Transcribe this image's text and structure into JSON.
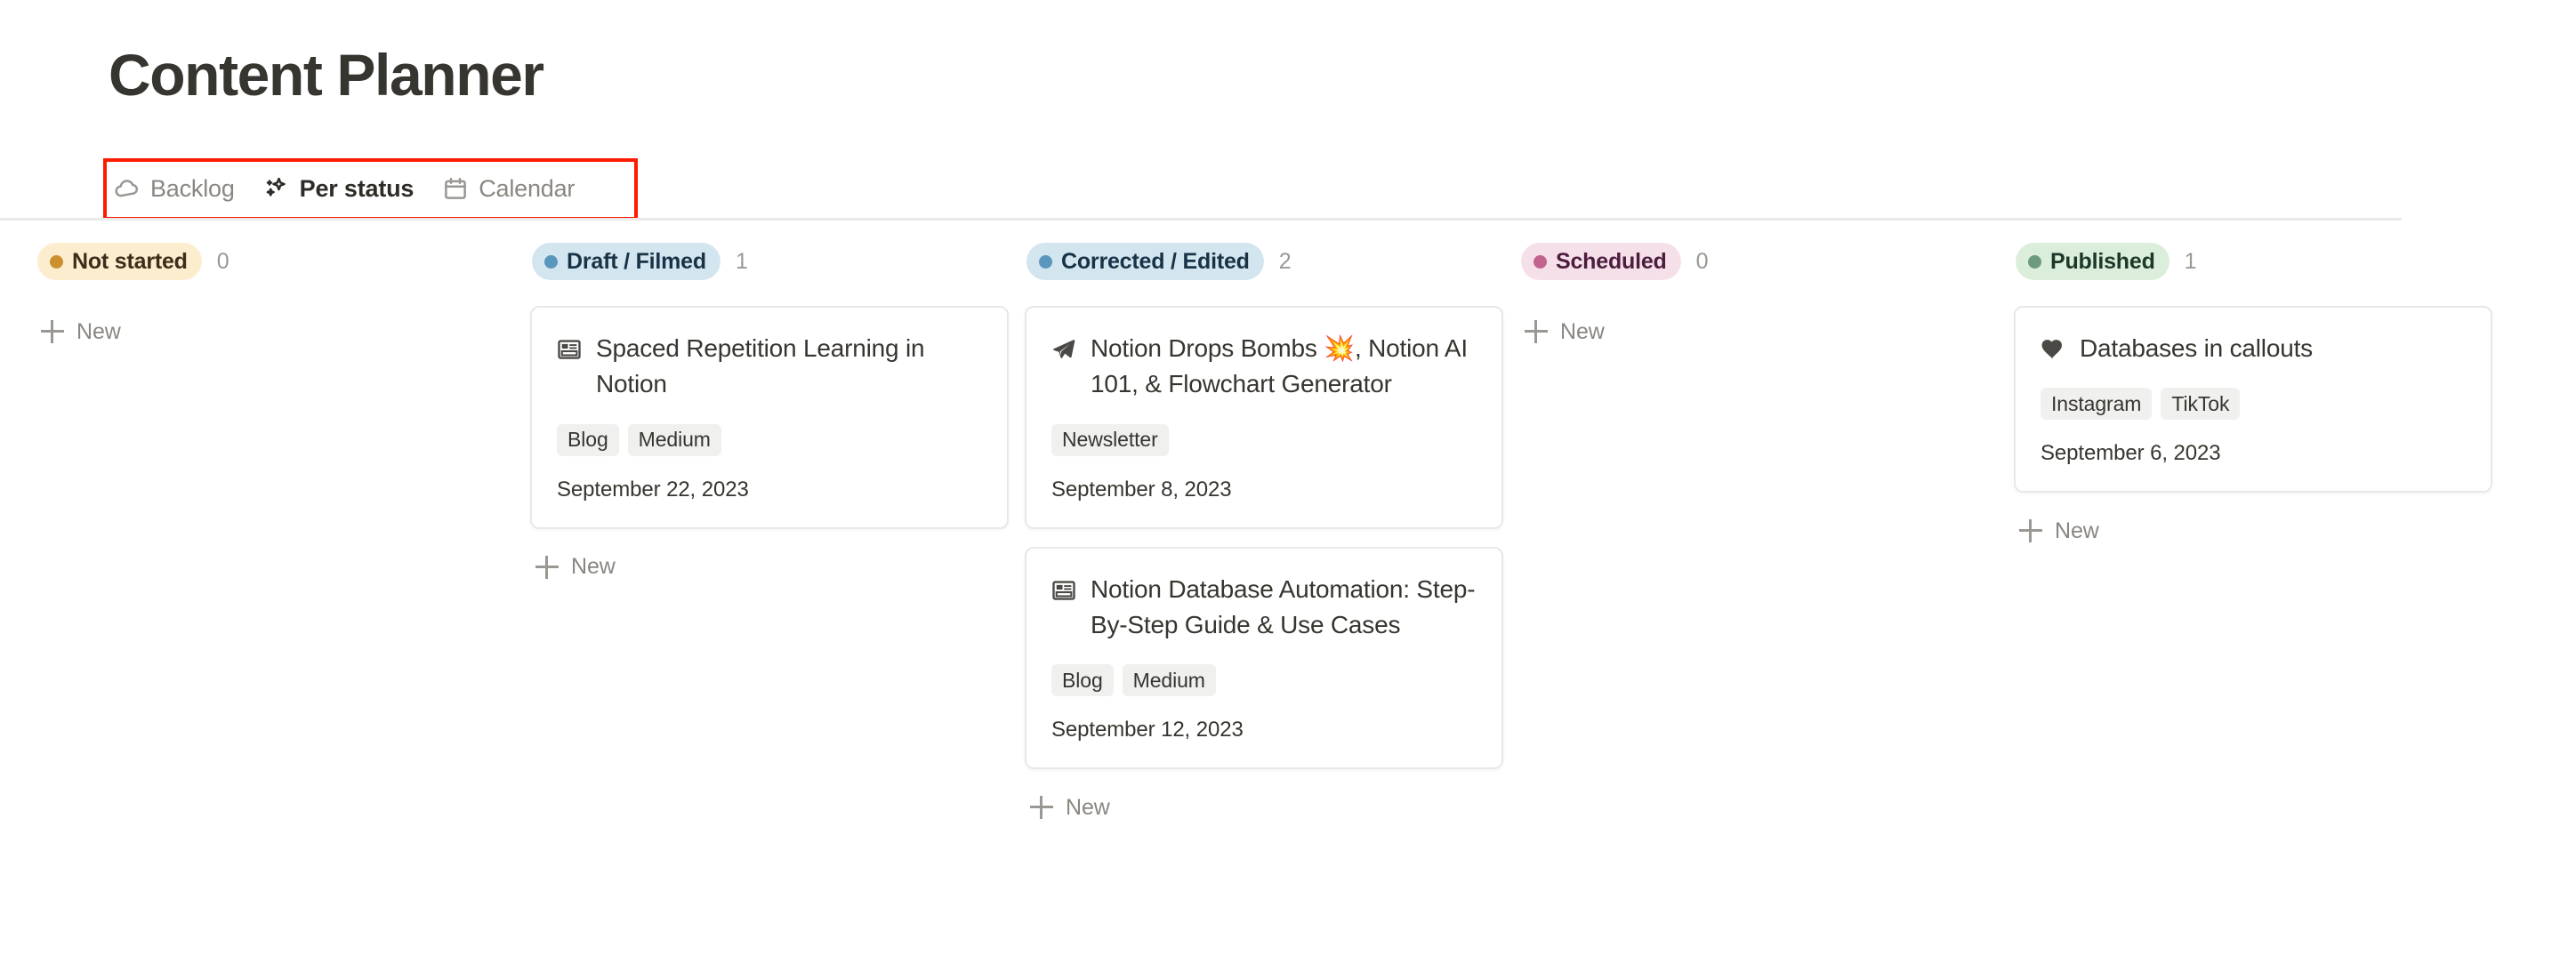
{
  "header": {
    "title": "Content Planner"
  },
  "tabs": [
    {
      "label": "Backlog",
      "icon": "cloud-icon",
      "active": false
    },
    {
      "label": "Per status",
      "icon": "sparkles-icon",
      "active": true
    },
    {
      "label": "Calendar",
      "icon": "calendar-icon",
      "active": false
    }
  ],
  "new_button_label": "New",
  "colors": {
    "not_started_bg": "#fbedce",
    "not_started_text": "#402c1b",
    "not_started_dot": "#cb912f",
    "draft_bg": "#d3e5ef",
    "draft_text": "#183347",
    "draft_dot": "#5b97bd",
    "corrected_bg": "#d3e5ef",
    "corrected_text": "#183347",
    "corrected_dot": "#5b97bd",
    "scheduled_bg": "#f5e0ea",
    "scheduled_text": "#4c1d3d",
    "scheduled_dot": "#c2638f",
    "published_bg": "#dbeddb",
    "published_text": "#1c3829",
    "published_dot": "#6c9b7d",
    "annotation": "#ff1a00"
  },
  "columns": [
    {
      "status": "Not started",
      "count": "0",
      "pill_bg": "#fbedce",
      "pill_text": "#402c1b",
      "dot": "#cb912f",
      "cards": []
    },
    {
      "status": "Draft / Filmed",
      "count": "1",
      "pill_bg": "#d3e5ef",
      "pill_text": "#183347",
      "dot": "#5b97bd",
      "cards": [
        {
          "icon": "newspaper-icon",
          "title": "Spaced Repetition Learning in Notion",
          "tags": [
            "Blog",
            "Medium"
          ],
          "date": "September 22, 2023"
        }
      ]
    },
    {
      "status": "Corrected / Edited",
      "count": "2",
      "pill_bg": "#d3e5ef",
      "pill_text": "#183347",
      "dot": "#5b97bd",
      "cards": [
        {
          "icon": "paper-plane-icon",
          "title": "Notion Drops Bombs 💥, Notion AI 101, & Flowchart Generator",
          "tags": [
            "Newsletter"
          ],
          "date": "September 8, 2023"
        },
        {
          "icon": "newspaper-icon",
          "title": "Notion Database Automation: Step-By-Step Guide & Use Cases",
          "tags": [
            "Blog",
            "Medium"
          ],
          "date": "September 12, 2023"
        }
      ]
    },
    {
      "status": "Scheduled",
      "count": "0",
      "pill_bg": "#f5e0ea",
      "pill_text": "#4c1d3d",
      "dot": "#c2638f",
      "cards": []
    },
    {
      "status": "Published",
      "count": "1",
      "pill_bg": "#dbeddb",
      "pill_text": "#1c3829",
      "dot": "#6c9b7d",
      "cards": [
        {
          "icon": "heart-icon",
          "title": "Databases in callouts",
          "tags": [
            "Instagram",
            "TikTok"
          ],
          "date": "September 6, 2023"
        }
      ]
    }
  ]
}
